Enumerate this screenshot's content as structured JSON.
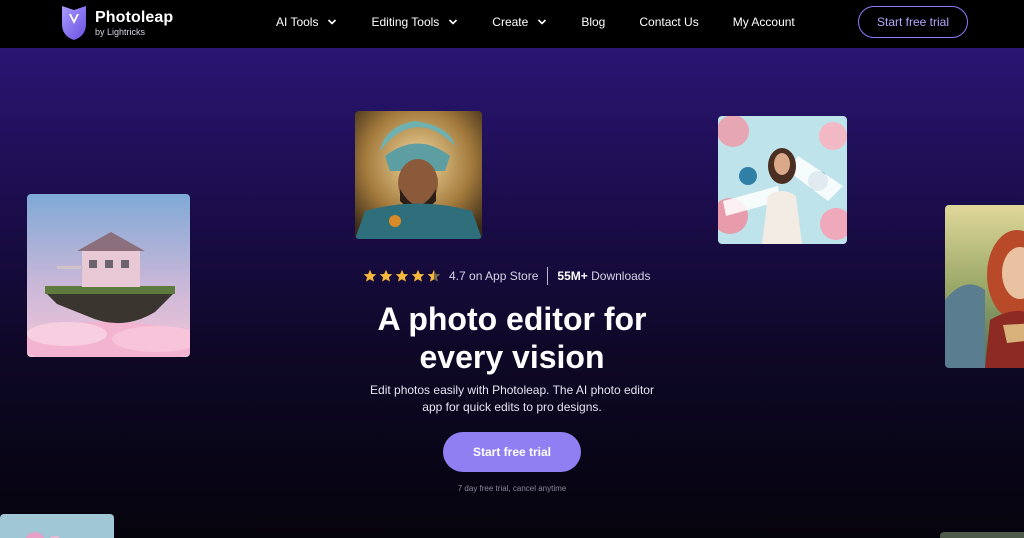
{
  "brand": {
    "name": "Photoleap",
    "byline": "by Lightricks",
    "accent": "#8f7ff2"
  },
  "nav": {
    "items": [
      {
        "label": "AI Tools",
        "has_menu": true
      },
      {
        "label": "Editing Tools",
        "has_menu": true
      },
      {
        "label": "Create",
        "has_menu": true
      },
      {
        "label": "Blog",
        "has_menu": false
      },
      {
        "label": "Contact Us",
        "has_menu": false
      },
      {
        "label": "My Account",
        "has_menu": false
      }
    ],
    "cta_label": "Start free trial"
  },
  "hero": {
    "rating": {
      "stars": 4.5,
      "text": "4.7 on App Store",
      "downloads_count": "55M+",
      "downloads_word": "Downloads"
    },
    "headline_line1": "A photo editor for",
    "headline_line2": "every vision",
    "subtitle_line1": "Edit photos easily with Photoleap. The AI photo editor",
    "subtitle_line2": "app for quick edits to pro designs.",
    "cta_label": "Start free trial",
    "fineprint": "7 day free trial, cancel anytime",
    "tiles": [
      {
        "name": "floating-house-image"
      },
      {
        "name": "armored-warrior-image"
      },
      {
        "name": "floral-collage-woman-image"
      },
      {
        "name": "red-haired-woman-portrait-image"
      },
      {
        "name": "pink-flowers-image"
      },
      {
        "name": "partial-image"
      }
    ]
  }
}
